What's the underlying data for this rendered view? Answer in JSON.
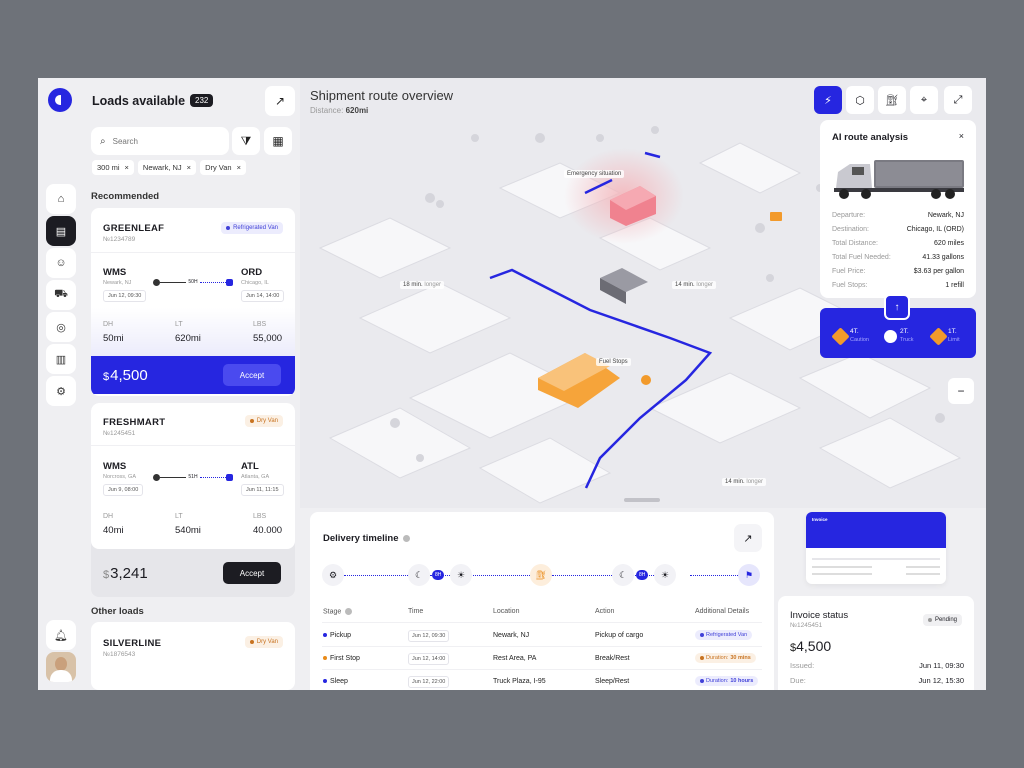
{
  "sidebar": {
    "title": "Loads available",
    "count": "232",
    "search_placeholder": "Search",
    "filters": [
      "300 mi",
      "Newark, NJ",
      "Dry Van"
    ],
    "recommended_label": "Recommended",
    "other_label": "Other loads"
  },
  "loads": [
    {
      "name": "GREENLEAF",
      "number": "№1234789",
      "tag": "Refrigerated Van",
      "tag_color": "blue",
      "from": "WMS",
      "from_sub": "Newark, NJ",
      "from_date": "Jun 12, 09:30",
      "duration": "50H",
      "to": "ORD",
      "to_sub": "Chicago, IL",
      "to_date": "Jun 14, 14:00",
      "stats": {
        "dh_label": "DH",
        "dh": "50mi",
        "lt_label": "LT",
        "lt": "620mi",
        "lbs_label": "LBS",
        "lbs": "55,000"
      },
      "currency": "$",
      "price": "4,500",
      "accept": "Accept"
    },
    {
      "name": "FRESHMART",
      "number": "№1245451",
      "tag": "Dry Van",
      "tag_color": "orange",
      "from": "WMS",
      "from_sub": "Norcross, GA",
      "from_date": "Jun 9, 08:00",
      "duration": "51H",
      "to": "ATL",
      "to_sub": "Atlanta, GA",
      "to_date": "Jun 11, 11:15",
      "stats": {
        "dh_label": "DH",
        "dh": "40mi",
        "lt_label": "LT",
        "lt": "540mi",
        "lbs_label": "LBS",
        "lbs": "40.000"
      },
      "currency": "$",
      "price": "3,241",
      "accept": "Accept"
    },
    {
      "name": "SILVERLINE",
      "number": "№1876543",
      "tag": "Dry Van",
      "tag_color": "orange"
    }
  ],
  "map": {
    "title": "Shipment route overview",
    "distance_label": "Distance:",
    "distance": "620mi",
    "labels": {
      "emergency": "Emergency situation",
      "fuel": "Fuel Stops",
      "eta1": "18 min.",
      "eta1_suffix": "longer",
      "eta2": "14 min.",
      "eta2_suffix": "longer",
      "eta3": "14 min.",
      "eta3_suffix": "longer"
    },
    "tools": [
      "route-icon",
      "box-icon",
      "fuel-icon",
      "pin-icon",
      "expand-icon"
    ]
  },
  "ai_analysis": {
    "title": "AI route analysis",
    "rows": [
      {
        "k": "Departure:",
        "v": "Newark, NJ"
      },
      {
        "k": "Destination:",
        "v": "Chicago, IL (ORD)"
      },
      {
        "k": "Total Distance:",
        "v": "620 miles"
      },
      {
        "k": "Total Fuel Needed:",
        "v": "41.33 gallons"
      },
      {
        "k": "Fuel Price:",
        "v": "$3.63 per gallon"
      },
      {
        "k": "Fuel Stops:",
        "v": "1 refill"
      }
    ],
    "badges": [
      {
        "num": "4T.",
        "label": "Caution"
      },
      {
        "num": "2T.",
        "label": "Truck"
      },
      {
        "num": "1T.",
        "label": "Limit"
      }
    ]
  },
  "timeline": {
    "title": "Delivery timeline",
    "pills": [
      "8H",
      "8H"
    ],
    "headers": [
      "Stage",
      "Time",
      "Location",
      "Action",
      "Additional Details"
    ],
    "rows": [
      {
        "stage": "Pickup",
        "color": "#2626e0",
        "time": "Jun 12, 09:30",
        "location": "Newark, NJ",
        "action": "Pickup of cargo",
        "detail": "Refrigerated Van",
        "detail_type": "b"
      },
      {
        "stage": "First Stop",
        "color": "#e98a18",
        "time": "Jun 12, 14:00",
        "location": "Rest Area, PA",
        "action": "Break/Rest",
        "detail_key": "Duration:",
        "detail": "30 mins",
        "detail_type": "o"
      },
      {
        "stage": "Sleep",
        "color": "#2626e0",
        "time": "Jun 12, 22:00",
        "location": "Truck Plaza, I-95",
        "action": "Sleep/Rest",
        "detail_key": "Duration:",
        "detail": "10 hours",
        "detail_type": "b"
      }
    ]
  },
  "invoice": {
    "preview_title": "Invoice",
    "title": "Invoice status",
    "number": "№1245451",
    "status": "Pending",
    "currency": "$",
    "amount": "4,500",
    "issued_label": "Issued:",
    "issued": "Jun 11, 09:30",
    "due_label": "Due:",
    "due": "Jun 12, 15:30"
  },
  "colors": {
    "accent": "#2626e0",
    "warn": "#e98a18",
    "dark": "#1c1c22"
  }
}
